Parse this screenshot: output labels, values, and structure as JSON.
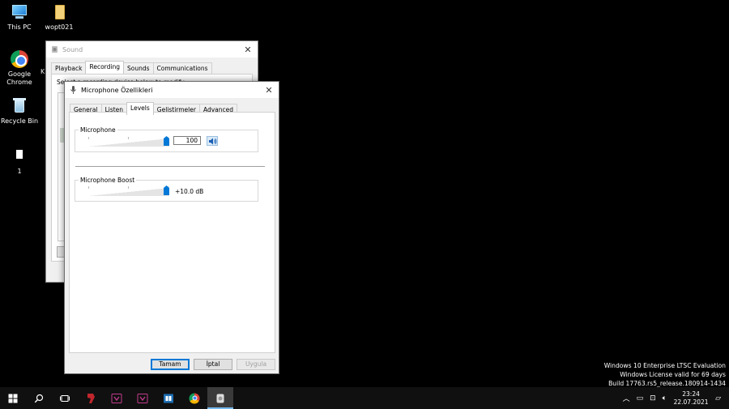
{
  "desktop": {
    "icons": [
      {
        "label": "This PC",
        "icon": "computer-icon"
      },
      {
        "label": "wopt021",
        "icon": "file-icon"
      },
      {
        "label": "Google Chrome",
        "icon": "chrome-icon"
      },
      {
        "label": "Recycle Bin",
        "icon": "recycle-bin-icon"
      },
      {
        "label": "1",
        "icon": "file-icon"
      }
    ],
    "stray_label": "K"
  },
  "sound_window": {
    "title": "Sound",
    "tabs": [
      "Playback",
      "Recording",
      "Sounds",
      "Communications"
    ],
    "selected_tab": "Recording",
    "hint_text": "Select a recording device below to modify its settings:"
  },
  "mic_dialog": {
    "title": "Microphone Özellikleri",
    "tabs": [
      "General",
      "Listen",
      "Levels",
      "Geliştirmeler",
      "Advanced"
    ],
    "selected_tab": "Levels",
    "microphone_group": {
      "label": "Microphone",
      "value": "100",
      "level": 1.0
    },
    "boost_group": {
      "label": "Microphone Boost",
      "value": "+10.0 dB",
      "level": 1.0
    },
    "buttons": {
      "ok": "Tamam",
      "cancel": "İptal",
      "apply": "Uygula"
    }
  },
  "watermark": {
    "line1": "Windows 10 Enterprise LTSC Evaluation",
    "line2": "Windows License valid for 69 days",
    "line3": "Build 17763.rs5_release.180914-1434"
  },
  "taskbar": {
    "time": "23:24",
    "date": "22.07.2021"
  },
  "colors": {
    "accent": "#0078d7",
    "desktop": "#000000",
    "taskbar": "#101010"
  }
}
